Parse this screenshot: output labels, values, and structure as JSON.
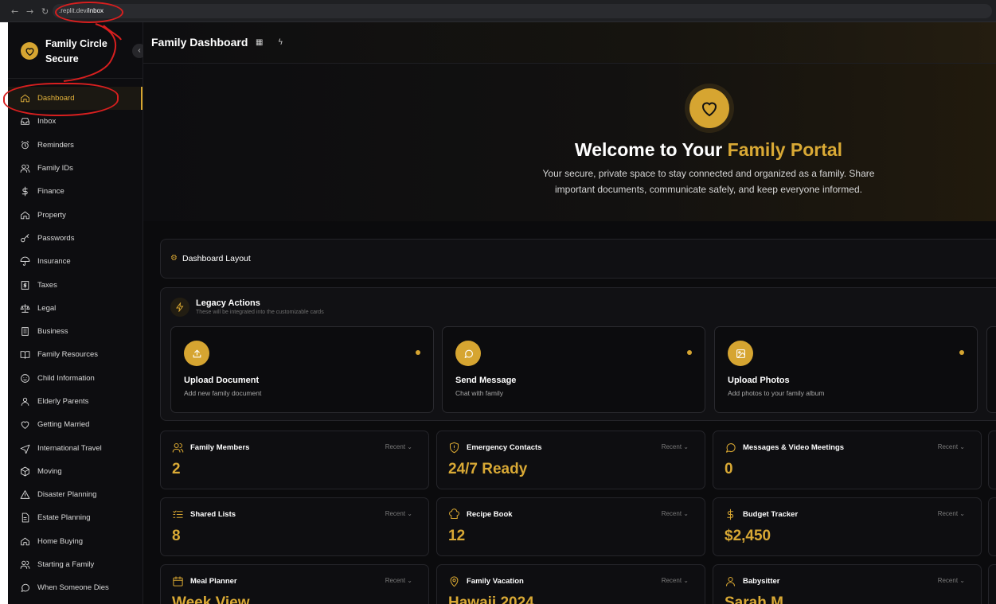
{
  "browser": {
    "url_prefix": ".replit.dev",
    "url_path": "/inbox"
  },
  "sidebar": {
    "brand": "Family Circle Secure",
    "items": [
      {
        "label": "Dashboard",
        "icon": "home-icon",
        "active": true
      },
      {
        "label": "Inbox",
        "icon": "inbox-icon"
      },
      {
        "label": "Reminders",
        "icon": "alarm-icon"
      },
      {
        "label": "Family IDs",
        "icon": "users-icon"
      },
      {
        "label": "Finance",
        "icon": "dollar-icon"
      },
      {
        "label": "Property",
        "icon": "home-icon"
      },
      {
        "label": "Passwords",
        "icon": "key-icon"
      },
      {
        "label": "Insurance",
        "icon": "umbrella-icon"
      },
      {
        "label": "Taxes",
        "icon": "receipt-icon"
      },
      {
        "label": "Legal",
        "icon": "scale-icon"
      },
      {
        "label": "Business",
        "icon": "building-icon"
      },
      {
        "label": "Family Resources",
        "icon": "book-icon"
      },
      {
        "label": "Child Information",
        "icon": "baby-icon"
      },
      {
        "label": "Elderly Parents",
        "icon": "user-icon"
      },
      {
        "label": "Getting Married",
        "icon": "heart-icon"
      },
      {
        "label": "International Travel",
        "icon": "plane-icon"
      },
      {
        "label": "Moving",
        "icon": "box-icon"
      },
      {
        "label": "Disaster Planning",
        "icon": "alert-icon"
      },
      {
        "label": "Estate Planning",
        "icon": "document-icon"
      },
      {
        "label": "Home Buying",
        "icon": "home-icon"
      },
      {
        "label": "Starting a Family",
        "icon": "users-icon"
      },
      {
        "label": "When Someone Dies",
        "icon": "chat-icon"
      }
    ]
  },
  "header": {
    "title": "Family Dashboard"
  },
  "hero": {
    "title_white": "Welcome to Your ",
    "title_gold": "Family Portal",
    "subtitle": "Your secure, private space to stay connected and organized as a family. Share important documents, communicate safely, and keep everyone informed."
  },
  "layout_bar": {
    "label": "Dashboard Layout"
  },
  "legacy": {
    "title": "Legacy Actions",
    "subtitle": "These will be integrated into the customizable cards",
    "actions": [
      {
        "title": "Upload Document",
        "subtitle": "Add new family document",
        "icon": "upload-icon"
      },
      {
        "title": "Send Message",
        "subtitle": "Chat with family",
        "icon": "message-icon"
      },
      {
        "title": "Upload Photos",
        "subtitle": "Add photos to your family album",
        "icon": "image-icon"
      }
    ]
  },
  "cards": [
    {
      "title": "Family Members",
      "value": "2",
      "filter": "Recent",
      "icon": "users-icon"
    },
    {
      "title": "Emergency Contacts",
      "value": "24/7 Ready",
      "filter": "Recent",
      "icon": "shield-alert-icon"
    },
    {
      "title": "Messages & Video Meetings",
      "value": "0",
      "filter": "Recent",
      "icon": "chat-icon"
    },
    {
      "title": "Shared Lists",
      "value": "8",
      "filter": "Recent",
      "icon": "list-icon"
    },
    {
      "title": "Recipe Book",
      "value": "12",
      "filter": "Recent",
      "icon": "chef-hat-icon"
    },
    {
      "title": "Budget Tracker",
      "value": "$2,450",
      "filter": "Recent",
      "icon": "dollar-icon"
    },
    {
      "title": "Meal Planner",
      "value": "Week View",
      "filter": "Recent",
      "icon": "calendar-icon"
    },
    {
      "title": "Family Vacation",
      "value": "Hawaii 2024",
      "filter": "Recent",
      "icon": "map-pin-icon"
    },
    {
      "title": "Babysitter",
      "value": "Sarah M.",
      "filter": "Recent",
      "icon": "user-icon"
    }
  ],
  "colors": {
    "accent": "#d6a531",
    "background": "#0b0b0d",
    "annotation": "#d81f1f"
  }
}
